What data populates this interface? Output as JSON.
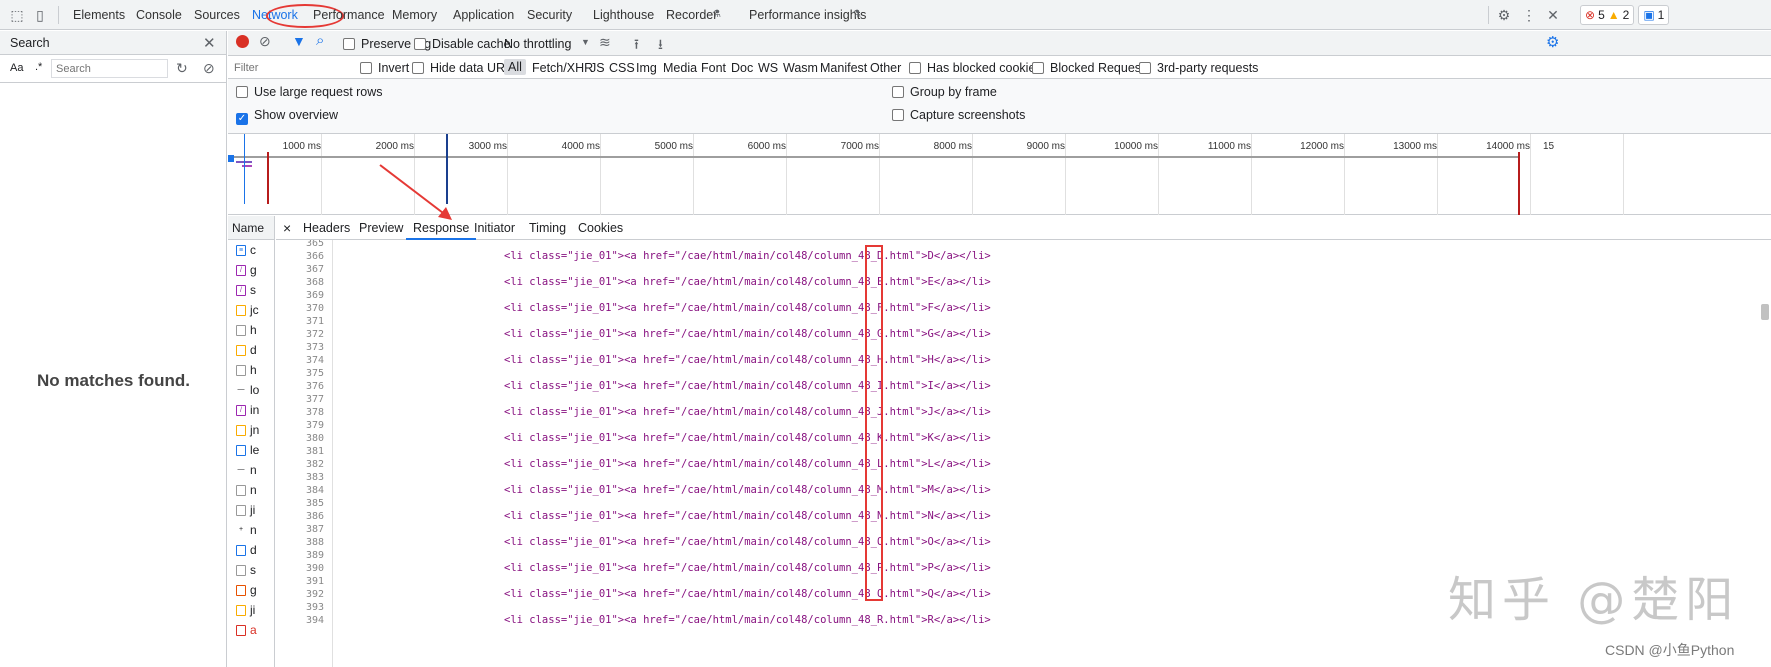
{
  "toolbar": {
    "tabs": [
      "Elements",
      "Console",
      "Sources",
      "Network",
      "Performance",
      "Memory",
      "Application",
      "Security",
      "Lighthouse",
      "Recorder",
      "Performance insights"
    ],
    "active_tab": "Network",
    "errors": "5",
    "warnings": "2",
    "messages": "1"
  },
  "search_panel": {
    "title": "Search",
    "case_toggle": "Aa",
    "regex_toggle": ".*",
    "placeholder": "Search",
    "no_matches": "No matches found."
  },
  "network": {
    "preserve_log": "Preserve log",
    "disable_cache": "Disable cache",
    "throttling": "No throttling",
    "filter_placeholder": "Filter",
    "invert": "Invert",
    "hide_data_urls": "Hide data URLs",
    "type_filters": [
      "All",
      "Fetch/XHR",
      "JS",
      "CSS",
      "Img",
      "Media",
      "Font",
      "Doc",
      "WS",
      "Wasm",
      "Manifest",
      "Other"
    ],
    "has_blocked_cookies": "Has blocked cookies",
    "blocked_requests": "Blocked Requests",
    "third_party": "3rd-party requests",
    "large_rows": "Use large request rows",
    "show_overview": "Show overview",
    "group_by_frame": "Group by frame",
    "capture_screenshots": "Capture screenshots",
    "timeline_labels": [
      "1000 ms",
      "2000 ms",
      "3000 ms",
      "4000 ms",
      "5000 ms",
      "6000 ms",
      "7000 ms",
      "8000 ms",
      "9000 ms",
      "10000 ms",
      "11000 ms",
      "12000 ms",
      "13000 ms",
      "14000 ms",
      "15"
    ],
    "name_header": "Name",
    "names": [
      "c",
      "g",
      "s",
      "jc",
      "h",
      "d",
      "h",
      "lo",
      "in",
      "jn",
      "le",
      "n",
      "n",
      "ji",
      "n",
      "d",
      "s",
      "g",
      "ji",
      "a"
    ]
  },
  "detail": {
    "close": "×",
    "tabs": [
      "Headers",
      "Preview",
      "Response",
      "Initiator",
      "Timing",
      "Cookies"
    ],
    "active_tab": "Response",
    "line_numbers": [
      "365",
      "366",
      "367",
      "368",
      "369",
      "370",
      "371",
      "372",
      "373",
      "374",
      "375",
      "376",
      "377",
      "378",
      "379",
      "380",
      "381",
      "382",
      "383",
      "384",
      "385",
      "386",
      "387",
      "388",
      "389",
      "390",
      "391",
      "392",
      "393",
      "394"
    ],
    "code_lines": [
      "<li class=\"jie_01\"><a href=\"/cae/html/main/col48/column_48_D.html\">D</a></li>",
      "<li class=\"jie_01\"><a href=\"/cae/html/main/col48/column_48_E.html\">E</a></li>",
      "<li class=\"jie_01\"><a href=\"/cae/html/main/col48/column_48_F.html\">F</a></li>",
      "<li class=\"jie_01\"><a href=\"/cae/html/main/col48/column_48_G.html\">G</a></li>",
      "<li class=\"jie_01\"><a href=\"/cae/html/main/col48/column_48_H.html\">H</a></li>",
      "<li class=\"jie_01\"><a href=\"/cae/html/main/col48/column_48_I.html\">I</a></li>",
      "<li class=\"jie_01\"><a href=\"/cae/html/main/col48/column_48_J.html\">J</a></li>",
      "<li class=\"jie_01\"><a href=\"/cae/html/main/col48/column_48_K.html\">K</a></li>",
      "<li class=\"jie_01\"><a href=\"/cae/html/main/col48/column_48_L.html\">L</a></li>",
      "<li class=\"jie_01\"><a href=\"/cae/html/main/col48/column_48_M.html\">M</a></li>",
      "<li class=\"jie_01\"><a href=\"/cae/html/main/col48/column_48_N.html\">N</a></li>",
      "<li class=\"jie_01\"><a href=\"/cae/html/main/col48/column_48_O.html\">O</a></li>",
      "<li class=\"jie_01\"><a href=\"/cae/html/main/col48/column_48_P.html\">P</a></li>",
      "<li class=\"jie_01\"><a href=\"/cae/html/main/col48/column_48_Q.html\">Q</a></li>",
      "<li class=\"jie_01\"><a href=\"/cae/html/main/col48/column_48_R.html\">R</a></li>"
    ]
  },
  "watermark": "知乎 @楚阳",
  "credit": "CSDN @小鱼Python",
  "colors": {
    "accent": "#1a73e8",
    "annotation": "#e53935",
    "record": "#d93025"
  }
}
